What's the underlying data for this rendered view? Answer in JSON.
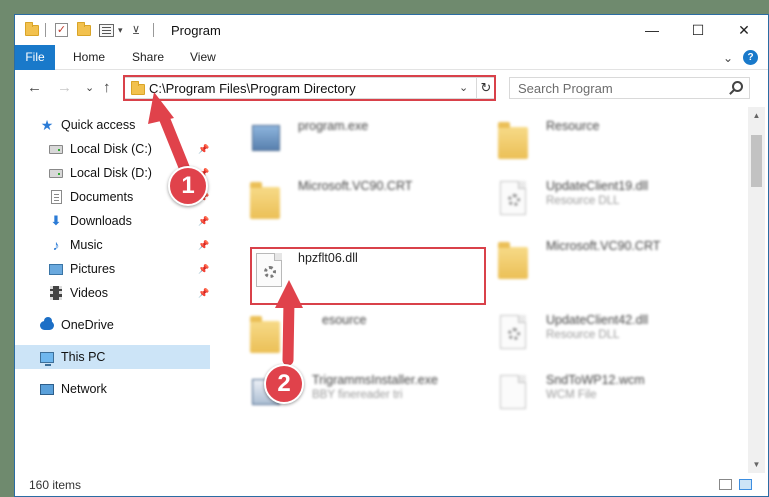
{
  "titlebar": {
    "title": "Program",
    "minimize": "—",
    "maximize": "☐",
    "close": "✕"
  },
  "ribbon": {
    "tabs": [
      {
        "label": "File"
      },
      {
        "label": "Home"
      },
      {
        "label": "Share"
      },
      {
        "label": "View"
      }
    ],
    "expand_glyph": "⌄",
    "help_glyph": "?"
  },
  "navigation": {
    "back": "←",
    "forward": "→",
    "recent": "⌄",
    "up": "↑",
    "address_path": "C:\\Program Files\\Program Directory",
    "address_chevron": "⌄",
    "refresh": "↻",
    "search_placeholder": "Search Program"
  },
  "navpane": {
    "items": [
      {
        "label": "Quick access",
        "icon": "star-icon",
        "pinned": false
      },
      {
        "label": "Local Disk (C:)",
        "icon": "drive-icon",
        "pinned": true
      },
      {
        "label": "Local Disk (D:)",
        "icon": "drive-icon",
        "pinned": true
      },
      {
        "label": "Documents",
        "icon": "documents-icon",
        "pinned": true
      },
      {
        "label": "Downloads",
        "icon": "download-icon",
        "pinned": true
      },
      {
        "label": "Music",
        "icon": "music-icon",
        "pinned": true
      },
      {
        "label": "Pictures",
        "icon": "pictures-icon",
        "pinned": true
      },
      {
        "label": "Videos",
        "icon": "videos-icon",
        "pinned": true
      },
      {
        "label": "OneDrive",
        "icon": "onedrive-icon",
        "pinned": false
      },
      {
        "label": "This PC",
        "icon": "this-pc-icon",
        "pinned": false,
        "selected": true
      },
      {
        "label": "Network",
        "icon": "network-icon",
        "pinned": false
      }
    ],
    "pin_glyph": "📌"
  },
  "files": [
    {
      "name": "program.exe",
      "sub": "",
      "icon": "exe-icon"
    },
    {
      "name": "Resource",
      "sub": "",
      "icon": "folder-icon"
    },
    {
      "name": "Microsoft.VC90.CRT",
      "sub": "",
      "icon": "folder-icon"
    },
    {
      "name": "UpdateClient19.dll",
      "sub": "Resource DLL",
      "icon": "dll-icon"
    },
    {
      "name": "hpzflt06.dll",
      "sub": "",
      "icon": "dll-icon",
      "highlighted": true
    },
    {
      "name": "Microsoft.VC90.CRT",
      "sub": "",
      "icon": "folder-icon"
    },
    {
      "name": "esource",
      "sub": "",
      "icon": "folder-icon"
    },
    {
      "name": "UpdateClient42.dll",
      "sub": "Resource DLL",
      "icon": "dll-icon"
    },
    {
      "name": "TrigrammsInstaller.exe",
      "sub": "BBY finereader tri",
      "icon": "exe-icon"
    },
    {
      "name": "SndToWP12.wcm",
      "sub": "WCM File",
      "icon": "file-icon"
    }
  ],
  "statusbar": {
    "item_count": "160 items"
  },
  "annotations": {
    "step1": "1",
    "step2": "2",
    "color": "#e0424b"
  }
}
